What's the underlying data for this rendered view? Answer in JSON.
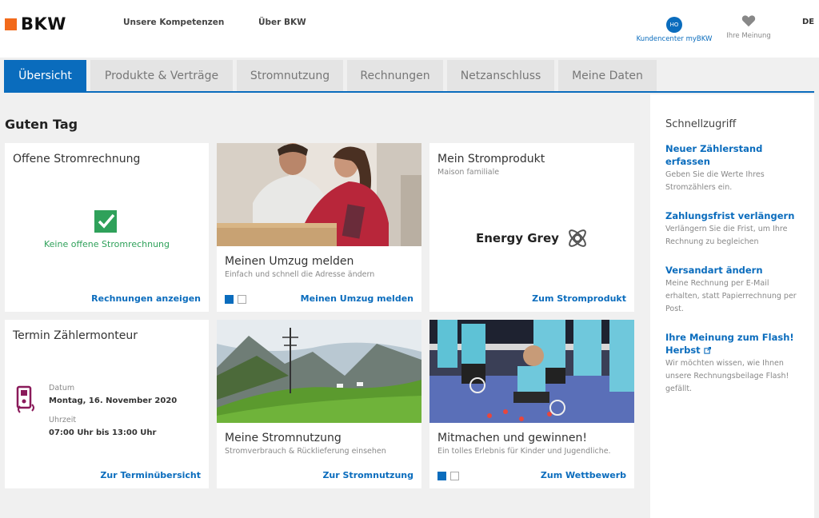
{
  "brand": {
    "name": "BKW",
    "accent": "#f26a1b",
    "primary": "#0a6cbd"
  },
  "topnav": {
    "competencies": "Unsere Kompetenzen",
    "about": "Über BKW"
  },
  "kundencenter": {
    "initials": "HO",
    "label": "Kundencenter myBKW"
  },
  "feedback": {
    "label": "Ihre Meinung",
    "icon": "heart-icon"
  },
  "language": "DE",
  "tabs": [
    {
      "label": "Übersicht"
    },
    {
      "label": "Produkte & Verträge"
    },
    {
      "label": "Stromnutzung"
    },
    {
      "label": "Rechnungen"
    },
    {
      "label": "Netzanschluss"
    },
    {
      "label": "Meine Daten"
    }
  ],
  "greeting": "Guten Tag",
  "cards": {
    "bill": {
      "title": "Offene Stromrechnung",
      "status": "Keine offene Stromrechnung",
      "link": "Rechnungen anzeigen"
    },
    "move": {
      "title": "Meinen Umzug melden",
      "subtitle": "Einfach und schnell die Adresse ändern",
      "link": "Meinen Umzug melden"
    },
    "product": {
      "title": "Mein Stromprodukt",
      "subtitle": "Maison familiale",
      "product_name": "Energy Grey",
      "link": "Zum Stromprodukt"
    },
    "appointment": {
      "title": "Termin Zählermonteur",
      "date_label": "Datum",
      "date_value": "Montag, 16. November 2020",
      "time_label": "Uhrzeit",
      "time_value": "07:00 Uhr bis 13:00 Uhr",
      "link": "Zur Terminübersicht"
    },
    "usage": {
      "title": "Meine Stromnutzung",
      "subtitle": "Stromverbrauch & Rücklieferung einsehen",
      "link": "Zur Stromnutzung"
    },
    "contest": {
      "title": "Mitmachen und gewinnen!",
      "subtitle": "Ein tolles Erlebnis für Kinder und Jugendliche.",
      "link": "Zum Wettbewerb"
    }
  },
  "sidebar": {
    "title": "Schnellzugriff",
    "items": [
      {
        "link": "Neuer Zählerstand erfassen",
        "desc": "Geben Sie die Werte Ihres Stromzählers ein."
      },
      {
        "link": "Zahlungsfrist verlängern",
        "desc": "Verlängern Sie die Frist, um Ihre Rechnung zu begleichen"
      },
      {
        "link": "Versandart ändern",
        "desc": "Meine Rechnung per E-Mail erhalten, statt Papierrechnung per Post."
      },
      {
        "link": "Ihre Meinung zum Flash! Herbst",
        "desc": "Wir möchten wissen, wie Ihnen unsere Rechnungsbeilage Flash! gefällt."
      }
    ]
  }
}
